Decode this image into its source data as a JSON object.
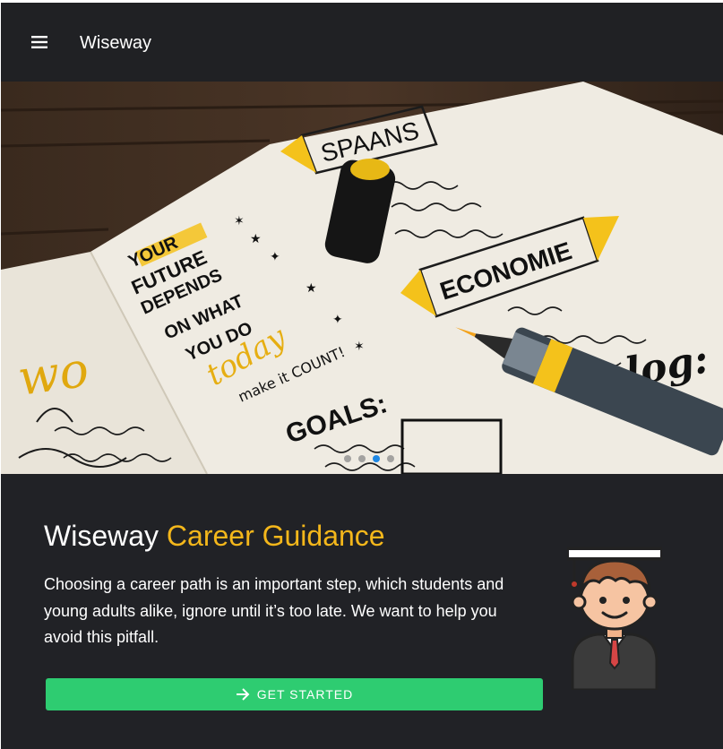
{
  "appbar": {
    "title": "Wiseway",
    "menu_icon": "menu-icon"
  },
  "hero": {
    "carousel": {
      "slide_count": 4,
      "active_index": 2
    },
    "notebook": {
      "heading_left_1": "YOUR",
      "heading_left_2": "FUTURE",
      "heading_left_3": "DEPENDS",
      "heading_left_4": "ON WHAT",
      "heading_left_5": "YOU DO",
      "today": "today",
      "make_it_count": "make it COUNT!",
      "spaans": "SPAANS",
      "economie": "ECONOMIE",
      "goals": "GOALS:",
      "wo": "wo",
      "log": "log:"
    }
  },
  "main": {
    "title_plain": "Wiseway",
    "title_accent": "Career Guidance",
    "description": "Choosing a career path is an important step, which students and young adults alike, ignore until it’s too late. We want to help you avoid this pitfall.",
    "cta_label": "GET STARTED",
    "cta_icon": "arrow-right-icon",
    "illustration": "graduate-icon"
  },
  "colors": {
    "accent": "#f4b71b",
    "cta": "#2ecc71",
    "background": "#212226"
  }
}
